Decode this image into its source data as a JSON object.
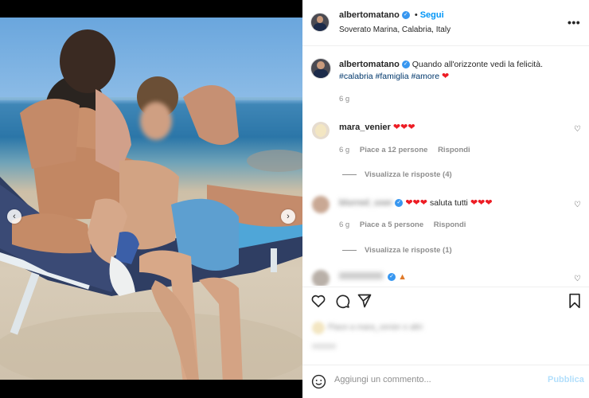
{
  "post": {
    "author": "albertomatano",
    "follow_label": "Segui",
    "location": "Soverato Marina, Calabria, Italy",
    "more_icon": "more-horizontal-icon"
  },
  "caption": {
    "username": "albertomatano",
    "text": "Quando all'orizzonte vedi la felicità.",
    "hashtags": "#calabria #famiglia #amore",
    "emoji": "❤",
    "time": "6 g"
  },
  "comments": [
    {
      "username": "mara_venier",
      "text": "❤❤❤",
      "time": "6 g",
      "likes": "Piace a 12 persone",
      "reply": "Rispondi",
      "view_replies": "Visualizza le risposte (4)"
    },
    {
      "username": "blurred_user",
      "text": "saluta tutti",
      "prefix_hearts": "❤❤❤",
      "suffix_hearts": "❤❤❤",
      "time": "6 g",
      "likes": "Piace a 5 persone",
      "reply": "Rispondi",
      "view_replies": "Visualizza le risposte (1)"
    }
  ],
  "likes_blurred": "Piace a mara_venier e altri",
  "add_comment_placeholder": "Aggiungi un commento...",
  "publish_label": "Pubblica",
  "colors": {
    "link_blue": "#0095f6",
    "hashtag": "#00376b",
    "heart_red": "#ed1c24",
    "muted": "#8e8e8e"
  }
}
